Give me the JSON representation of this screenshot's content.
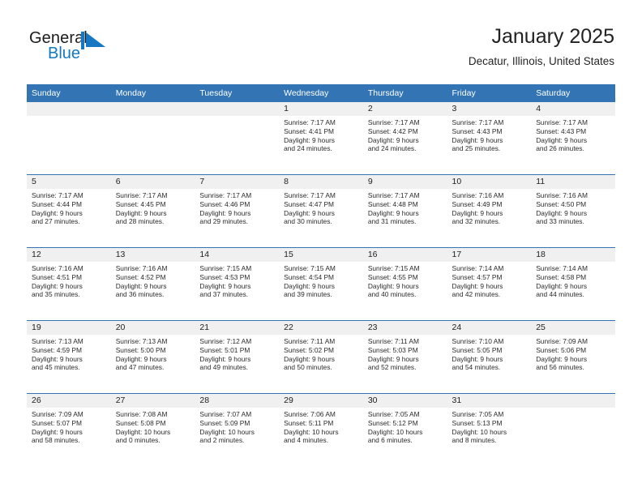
{
  "logo": {
    "text_top": "General",
    "text_bottom": "Blue",
    "mark": "triangle-flag-icon",
    "accent_color": "#1678c2"
  },
  "header": {
    "title": "January 2025",
    "subtitle": "Decatur, Illinois, United States"
  },
  "theme": {
    "header_blue": "#3375b4",
    "date_band_gray": "#f0f0f0",
    "text_color": "#222222"
  },
  "weekday_headers": [
    "Sunday",
    "Monday",
    "Tuesday",
    "Wednesday",
    "Thursday",
    "Friday",
    "Saturday"
  ],
  "weeks": [
    [
      {
        "day": "",
        "empty": true,
        "sunrise": "",
        "sunset": "",
        "daylight_line1": "",
        "daylight_line2": ""
      },
      {
        "day": "",
        "empty": true,
        "sunrise": "",
        "sunset": "",
        "daylight_line1": "",
        "daylight_line2": ""
      },
      {
        "day": "",
        "empty": true,
        "sunrise": "",
        "sunset": "",
        "daylight_line1": "",
        "daylight_line2": ""
      },
      {
        "day": "1",
        "empty": false,
        "sunrise": "Sunrise: 7:17 AM",
        "sunset": "Sunset: 4:41 PM",
        "daylight_line1": "Daylight: 9 hours",
        "daylight_line2": "and 24 minutes."
      },
      {
        "day": "2",
        "empty": false,
        "sunrise": "Sunrise: 7:17 AM",
        "sunset": "Sunset: 4:42 PM",
        "daylight_line1": "Daylight: 9 hours",
        "daylight_line2": "and 24 minutes."
      },
      {
        "day": "3",
        "empty": false,
        "sunrise": "Sunrise: 7:17 AM",
        "sunset": "Sunset: 4:43 PM",
        "daylight_line1": "Daylight: 9 hours",
        "daylight_line2": "and 25 minutes."
      },
      {
        "day": "4",
        "empty": false,
        "sunrise": "Sunrise: 7:17 AM",
        "sunset": "Sunset: 4:43 PM",
        "daylight_line1": "Daylight: 9 hours",
        "daylight_line2": "and 26 minutes."
      }
    ],
    [
      {
        "day": "5",
        "empty": false,
        "sunrise": "Sunrise: 7:17 AM",
        "sunset": "Sunset: 4:44 PM",
        "daylight_line1": "Daylight: 9 hours",
        "daylight_line2": "and 27 minutes."
      },
      {
        "day": "6",
        "empty": false,
        "sunrise": "Sunrise: 7:17 AM",
        "sunset": "Sunset: 4:45 PM",
        "daylight_line1": "Daylight: 9 hours",
        "daylight_line2": "and 28 minutes."
      },
      {
        "day": "7",
        "empty": false,
        "sunrise": "Sunrise: 7:17 AM",
        "sunset": "Sunset: 4:46 PM",
        "daylight_line1": "Daylight: 9 hours",
        "daylight_line2": "and 29 minutes."
      },
      {
        "day": "8",
        "empty": false,
        "sunrise": "Sunrise: 7:17 AM",
        "sunset": "Sunset: 4:47 PM",
        "daylight_line1": "Daylight: 9 hours",
        "daylight_line2": "and 30 minutes."
      },
      {
        "day": "9",
        "empty": false,
        "sunrise": "Sunrise: 7:17 AM",
        "sunset": "Sunset: 4:48 PM",
        "daylight_line1": "Daylight: 9 hours",
        "daylight_line2": "and 31 minutes."
      },
      {
        "day": "10",
        "empty": false,
        "sunrise": "Sunrise: 7:16 AM",
        "sunset": "Sunset: 4:49 PM",
        "daylight_line1": "Daylight: 9 hours",
        "daylight_line2": "and 32 minutes."
      },
      {
        "day": "11",
        "empty": false,
        "sunrise": "Sunrise: 7:16 AM",
        "sunset": "Sunset: 4:50 PM",
        "daylight_line1": "Daylight: 9 hours",
        "daylight_line2": "and 33 minutes."
      }
    ],
    [
      {
        "day": "12",
        "empty": false,
        "sunrise": "Sunrise: 7:16 AM",
        "sunset": "Sunset: 4:51 PM",
        "daylight_line1": "Daylight: 9 hours",
        "daylight_line2": "and 35 minutes."
      },
      {
        "day": "13",
        "empty": false,
        "sunrise": "Sunrise: 7:16 AM",
        "sunset": "Sunset: 4:52 PM",
        "daylight_line1": "Daylight: 9 hours",
        "daylight_line2": "and 36 minutes."
      },
      {
        "day": "14",
        "empty": false,
        "sunrise": "Sunrise: 7:15 AM",
        "sunset": "Sunset: 4:53 PM",
        "daylight_line1": "Daylight: 9 hours",
        "daylight_line2": "and 37 minutes."
      },
      {
        "day": "15",
        "empty": false,
        "sunrise": "Sunrise: 7:15 AM",
        "sunset": "Sunset: 4:54 PM",
        "daylight_line1": "Daylight: 9 hours",
        "daylight_line2": "and 39 minutes."
      },
      {
        "day": "16",
        "empty": false,
        "sunrise": "Sunrise: 7:15 AM",
        "sunset": "Sunset: 4:55 PM",
        "daylight_line1": "Daylight: 9 hours",
        "daylight_line2": "and 40 minutes."
      },
      {
        "day": "17",
        "empty": false,
        "sunrise": "Sunrise: 7:14 AM",
        "sunset": "Sunset: 4:57 PM",
        "daylight_line1": "Daylight: 9 hours",
        "daylight_line2": "and 42 minutes."
      },
      {
        "day": "18",
        "empty": false,
        "sunrise": "Sunrise: 7:14 AM",
        "sunset": "Sunset: 4:58 PM",
        "daylight_line1": "Daylight: 9 hours",
        "daylight_line2": "and 44 minutes."
      }
    ],
    [
      {
        "day": "19",
        "empty": false,
        "sunrise": "Sunrise: 7:13 AM",
        "sunset": "Sunset: 4:59 PM",
        "daylight_line1": "Daylight: 9 hours",
        "daylight_line2": "and 45 minutes."
      },
      {
        "day": "20",
        "empty": false,
        "sunrise": "Sunrise: 7:13 AM",
        "sunset": "Sunset: 5:00 PM",
        "daylight_line1": "Daylight: 9 hours",
        "daylight_line2": "and 47 minutes."
      },
      {
        "day": "21",
        "empty": false,
        "sunrise": "Sunrise: 7:12 AM",
        "sunset": "Sunset: 5:01 PM",
        "daylight_line1": "Daylight: 9 hours",
        "daylight_line2": "and 49 minutes."
      },
      {
        "day": "22",
        "empty": false,
        "sunrise": "Sunrise: 7:11 AM",
        "sunset": "Sunset: 5:02 PM",
        "daylight_line1": "Daylight: 9 hours",
        "daylight_line2": "and 50 minutes."
      },
      {
        "day": "23",
        "empty": false,
        "sunrise": "Sunrise: 7:11 AM",
        "sunset": "Sunset: 5:03 PM",
        "daylight_line1": "Daylight: 9 hours",
        "daylight_line2": "and 52 minutes."
      },
      {
        "day": "24",
        "empty": false,
        "sunrise": "Sunrise: 7:10 AM",
        "sunset": "Sunset: 5:05 PM",
        "daylight_line1": "Daylight: 9 hours",
        "daylight_line2": "and 54 minutes."
      },
      {
        "day": "25",
        "empty": false,
        "sunrise": "Sunrise: 7:09 AM",
        "sunset": "Sunset: 5:06 PM",
        "daylight_line1": "Daylight: 9 hours",
        "daylight_line2": "and 56 minutes."
      }
    ],
    [
      {
        "day": "26",
        "empty": false,
        "sunrise": "Sunrise: 7:09 AM",
        "sunset": "Sunset: 5:07 PM",
        "daylight_line1": "Daylight: 9 hours",
        "daylight_line2": "and 58 minutes."
      },
      {
        "day": "27",
        "empty": false,
        "sunrise": "Sunrise: 7:08 AM",
        "sunset": "Sunset: 5:08 PM",
        "daylight_line1": "Daylight: 10 hours",
        "daylight_line2": "and 0 minutes."
      },
      {
        "day": "28",
        "empty": false,
        "sunrise": "Sunrise: 7:07 AM",
        "sunset": "Sunset: 5:09 PM",
        "daylight_line1": "Daylight: 10 hours",
        "daylight_line2": "and 2 minutes."
      },
      {
        "day": "29",
        "empty": false,
        "sunrise": "Sunrise: 7:06 AM",
        "sunset": "Sunset: 5:11 PM",
        "daylight_line1": "Daylight: 10 hours",
        "daylight_line2": "and 4 minutes."
      },
      {
        "day": "30",
        "empty": false,
        "sunrise": "Sunrise: 7:05 AM",
        "sunset": "Sunset: 5:12 PM",
        "daylight_line1": "Daylight: 10 hours",
        "daylight_line2": "and 6 minutes."
      },
      {
        "day": "31",
        "empty": false,
        "sunrise": "Sunrise: 7:05 AM",
        "sunset": "Sunset: 5:13 PM",
        "daylight_line1": "Daylight: 10 hours",
        "daylight_line2": "and 8 minutes."
      },
      {
        "day": "",
        "empty": true,
        "sunrise": "",
        "sunset": "",
        "daylight_line1": "",
        "daylight_line2": ""
      }
    ]
  ]
}
